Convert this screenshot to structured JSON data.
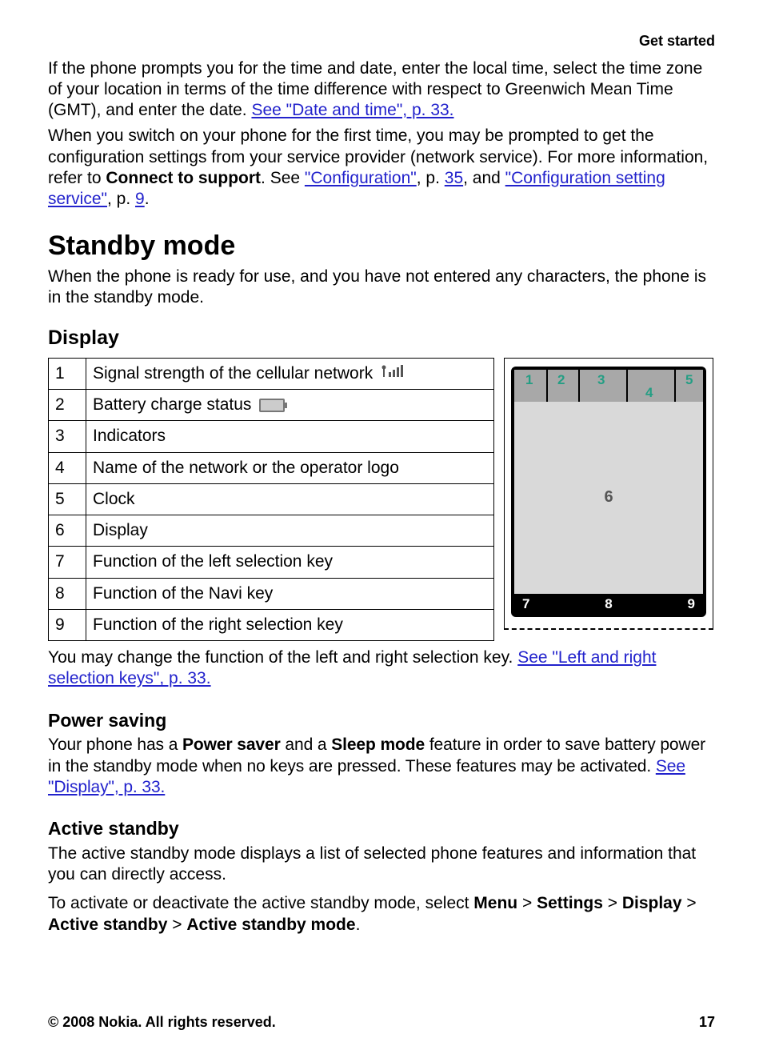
{
  "header": {
    "section": "Get started"
  },
  "intro": {
    "p1_a": "If the phone prompts you for the time and date, enter the local time, select the time zone of your location in terms of the time difference with respect to Greenwich Mean Time (GMT), and enter the date. ",
    "p1_link": "See \"Date and time\", p. 33.",
    "p2_a": "When you switch on your phone for the first time, you may be prompted to get the configuration settings from your service provider (network service). For more information, refer to ",
    "p2_bold": "Connect to support",
    "p2_b": ". See ",
    "p2_link1": "\"Configuration\"",
    "p2_c": ", p. ",
    "p2_link2": "35",
    "p2_d": ", and ",
    "p2_link3": "\"Configuration setting service\"",
    "p2_e": ", p. ",
    "p2_link4": "9",
    "p2_f": "."
  },
  "standby": {
    "heading": "Standby mode",
    "intro": "When the phone is ready for use, and you have not entered any characters, the phone is in the standby mode."
  },
  "display": {
    "heading": "Display",
    "rows": [
      {
        "n": "1",
        "text": "Signal strength of the cellular network "
      },
      {
        "n": "2",
        "text": "Battery charge status "
      },
      {
        "n": "3",
        "text": "Indicators"
      },
      {
        "n": "4",
        "text": "Name of the network or the operator logo"
      },
      {
        "n": "5",
        "text": "Clock"
      },
      {
        "n": "6",
        "text": "Display"
      },
      {
        "n": "7",
        "text": "Function of the left selection key"
      },
      {
        "n": "8",
        "text": "Function of the Navi key"
      },
      {
        "n": "9",
        "text": "Function of the right selection key"
      }
    ],
    "below_a": "You may change the function of the left and right selection key. ",
    "below_link": "See \"Left and right selection keys\", p. 33.",
    "phone_labels": {
      "l1": "1",
      "l2": "2",
      "l3": "3",
      "l4": "4",
      "l5": "5",
      "l6": "6",
      "l7": "7",
      "l8": "8",
      "l9": "9"
    }
  },
  "power_saving": {
    "heading": "Power saving",
    "a": "Your phone has a ",
    "bold1": "Power saver",
    "b": " and a ",
    "bold2": "Sleep mode",
    "c": " feature in order to save battery power in the standby mode when no keys are pressed. These features may be activated. ",
    "link": "See \"Display\", p. 33."
  },
  "active_standby": {
    "heading": "Active standby",
    "p1": "The active standby mode displays a list of selected phone features and information that you can directly access.",
    "p2_a": "To activate or deactivate the active standby mode, select ",
    "menu": "Menu",
    "gt": " > ",
    "settings": "Settings",
    "display_lbl": "Display",
    "active_standby_lbl": "Active standby",
    "active_standby_mode_lbl": "Active standby mode",
    "period": "."
  },
  "footer": {
    "copyright": "© 2008 Nokia. All rights reserved.",
    "page": "17"
  }
}
